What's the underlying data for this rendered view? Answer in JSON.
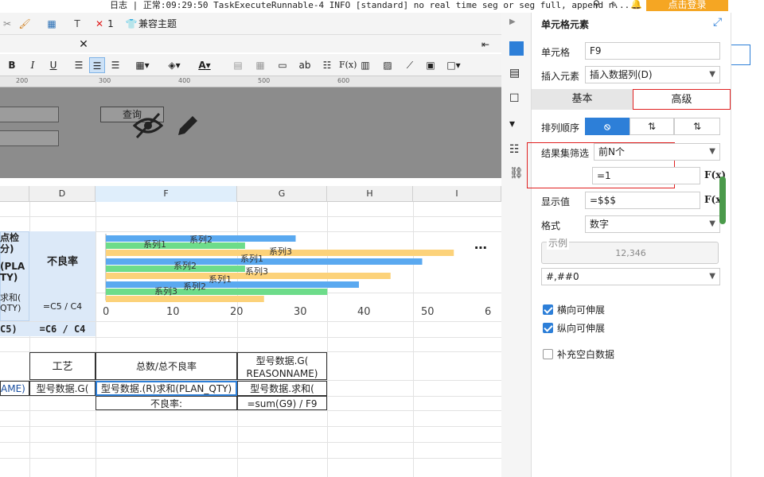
{
  "status_bar": {
    "log_text": "日志 | 正常:09:29:50 TaskExecuteRunnable-4 INFO [standard] no real time seg or seg full, append n...",
    "login_label": "点击登录"
  },
  "toolbar1": {
    "undo_count": "1",
    "compat_theme_label": "兼容主题"
  },
  "format_toolbar": {
    "bold": "B",
    "italic": "I",
    "underline": "U",
    "font_color_letter": "A",
    "ab_label": "ab",
    "fx_label": "F(x)"
  },
  "ruler": {
    "marks": [
      "200",
      "300",
      "400",
      "500",
      "600"
    ]
  },
  "param_pane": {
    "query_label": "查询"
  },
  "columns": [
    "D",
    "F",
    "G",
    "H",
    "I"
  ],
  "sheet": {
    "c1": "点检\n分)",
    "c2": "(PLA\nTY)",
    "c3": "求和(\nQTY)",
    "c4": "C5)",
    "d_label": "不良率",
    "d_formula1": "=C5 / C4",
    "d_formula2": "=C6 / C4",
    "process_label": "工艺",
    "total_label": "总数/总不良率",
    "g_header": "型号数据.G(\nREASONNAME)",
    "ame_cell": "AME)",
    "process_cell": "型号数据.G(",
    "sum_cell": "型号数据.(R)求和(PLAN_QTY)",
    "g_sum_cell": "型号数据.求和(",
    "bad_rate_label": "不良率:",
    "bad_rate_formula": "=sum(G9) / F9"
  },
  "chart_data": {
    "type": "bar",
    "orientation": "horizontal",
    "groups": [
      {
        "series": [
          {
            "name": "系列1",
            "value": 30
          },
          {
            "name": "系列2",
            "value": 22
          },
          {
            "name": "系列3",
            "value": 55
          }
        ]
      },
      {
        "series": [
          {
            "name": "系列1",
            "value": 50
          },
          {
            "name": "系列2",
            "value": 22
          },
          {
            "name": "系列3",
            "value": 45
          }
        ]
      },
      {
        "series": [
          {
            "name": "系列1",
            "value": 40
          },
          {
            "name": "系列2",
            "value": 35
          },
          {
            "name": "系列3",
            "value": 25
          }
        ]
      }
    ],
    "x_ticks": [
      "0",
      "10",
      "20",
      "30",
      "40",
      "50",
      "6"
    ],
    "xlim": [
      0,
      60
    ],
    "colors": {
      "系列1": "#5aa9f0",
      "系列2": "#6ddc8a",
      "系列3": "#fcd27a"
    }
  },
  "panel": {
    "title": "单元格元素",
    "cell_label": "单元格",
    "cell_value": "F9",
    "insert_label": "插入元素",
    "insert_value": "插入数据列(D)",
    "tab_basic": "基本",
    "tab_advanced": "高级",
    "sort_label": "排列顺序",
    "filter_label": "结果集筛选",
    "filter_value": "前N个",
    "filter_n": "=1",
    "display_label": "显示值",
    "display_value": "=$$$",
    "format_label": "格式",
    "format_value": "数字",
    "example_label": "示例",
    "example_value": "12,346",
    "pattern_value": "#,##0",
    "h_expand": "横向可伸展",
    "v_expand": "纵向可伸展",
    "fill_blank": "补充空白数据",
    "fx_label": "F(x)"
  },
  "accent_colors": {
    "login": "#f5a623",
    "active_blue": "#2d7fd8",
    "highlight": "#e02020"
  }
}
